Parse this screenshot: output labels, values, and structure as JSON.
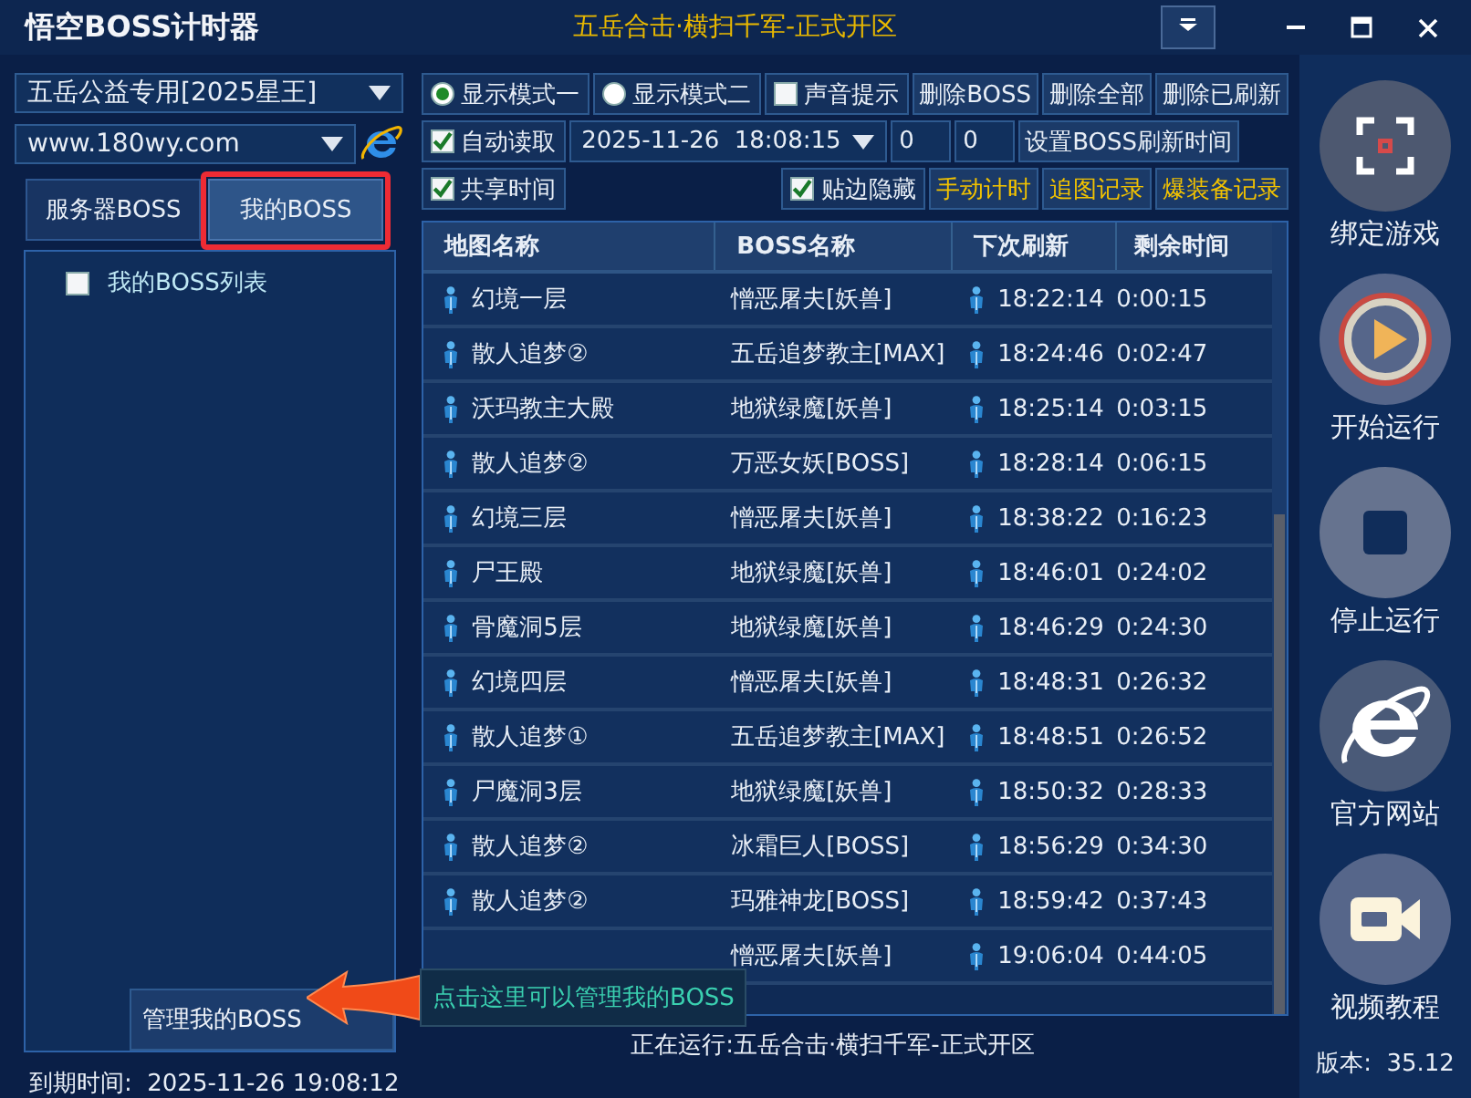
{
  "window": {
    "title": "悟空BOSS计时器",
    "marquee": "五岳合击·横扫千军-正式开区"
  },
  "left_panel": {
    "server_select": "五岳公益专用[2025星王]",
    "url_select": "www.180wy.com",
    "tabs": [
      {
        "label": "服务器BOSS",
        "selected": false,
        "highlighted": false
      },
      {
        "label": "我的BOSS",
        "selected": true,
        "highlighted": true
      }
    ],
    "tree": [
      {
        "label": "我的BOSS列表",
        "checked": false
      }
    ],
    "manage_button": "管理我的BOSS",
    "expiry": "到期时间:  2025-11-26 19:08:12"
  },
  "toolbar": [
    [
      {
        "kind": "radio",
        "label": "显示模式一",
        "selected": true
      },
      {
        "kind": "radio",
        "label": "显示模式二",
        "selected": false
      },
      {
        "kind": "checkbox",
        "label": "声音提示",
        "checked": false
      },
      {
        "kind": "button",
        "label": "删除BOSS",
        "accent": false
      },
      {
        "kind": "button",
        "label": "删除全部",
        "accent": false
      },
      {
        "kind": "button",
        "label": "删除已刷新",
        "accent": false
      }
    ],
    [
      {
        "kind": "checkbox",
        "label": "自动读取",
        "checked": true
      },
      {
        "kind": "datetime",
        "value": "2025-11-26  18:08:15"
      },
      {
        "kind": "field",
        "value": "0"
      },
      {
        "kind": "field",
        "value": "0"
      },
      {
        "kind": "button",
        "label": "设置BOSS刷新时间",
        "accent": false
      }
    ],
    [
      {
        "kind": "checkbox",
        "label": "共享时间",
        "checked": true
      },
      {
        "kind": "spacer"
      },
      {
        "kind": "checkbox",
        "label": "贴边隐藏",
        "checked": true
      },
      {
        "kind": "button",
        "label": "手动计时",
        "accent": true
      },
      {
        "kind": "button",
        "label": "追图记录",
        "accent": true
      },
      {
        "kind": "button",
        "label": "爆装备记录",
        "accent": true
      }
    ]
  ],
  "table": {
    "columns": [
      "地图名称",
      "BOSS名称",
      "下次刷新",
      "剩余时间"
    ],
    "rows": [
      {
        "map": "幻境一层",
        "boss": "憎恶屠夫[妖兽]",
        "next": "18:22:14",
        "remaining": "0:00:15"
      },
      {
        "map": "散人追梦②",
        "boss": "五岳追梦教主[MAX]",
        "next": "18:24:46",
        "remaining": "0:02:47"
      },
      {
        "map": "沃玛教主大殿",
        "boss": "地狱绿魔[妖兽]",
        "next": "18:25:14",
        "remaining": "0:03:15"
      },
      {
        "map": "散人追梦②",
        "boss": "万恶女妖[BOSS]",
        "next": "18:28:14",
        "remaining": "0:06:15"
      },
      {
        "map": "幻境三层",
        "boss": "憎恶屠夫[妖兽]",
        "next": "18:38:22",
        "remaining": "0:16:23"
      },
      {
        "map": "尸王殿",
        "boss": "地狱绿魔[妖兽]",
        "next": "18:46:01",
        "remaining": "0:24:02"
      },
      {
        "map": "骨魔洞5层",
        "boss": "地狱绿魔[妖兽]",
        "next": "18:46:29",
        "remaining": "0:24:30"
      },
      {
        "map": "幻境四层",
        "boss": "憎恶屠夫[妖兽]",
        "next": "18:48:31",
        "remaining": "0:26:32"
      },
      {
        "map": "散人追梦①",
        "boss": "五岳追梦教主[MAX]",
        "next": "18:48:51",
        "remaining": "0:26:52"
      },
      {
        "map": "尸魔洞3层",
        "boss": "地狱绿魔[妖兽]",
        "next": "18:50:32",
        "remaining": "0:28:33"
      },
      {
        "map": "散人追梦②",
        "boss": "冰霜巨人[BOSS]",
        "next": "18:56:29",
        "remaining": "0:34:30"
      },
      {
        "map": "散人追梦②",
        "boss": "玛雅神龙[BOSS]",
        "next": "18:59:42",
        "remaining": "0:37:43"
      },
      {
        "boss": "憎恶屠夫[妖兽]",
        "next": "19:06:04",
        "remaining": "0:44:05"
      }
    ]
  },
  "actions": [
    {
      "kind": "bind",
      "label": "绑定游戏"
    },
    {
      "kind": "start",
      "label": "开始运行"
    },
    {
      "kind": "stop",
      "label": "停止运行"
    },
    {
      "kind": "web",
      "label": "官方网站"
    },
    {
      "kind": "video",
      "label": "视频教程"
    }
  ],
  "version": "版本:  35.12",
  "status_bar": "正在运行:五岳合击·横扫千军-正式开区",
  "tooltip": "点击这里可以管理我的BOSS"
}
